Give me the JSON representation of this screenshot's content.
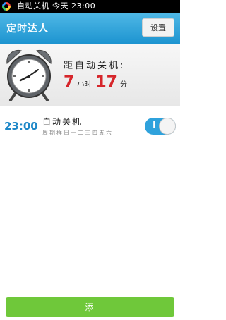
{
  "status_bar": {
    "text": "自动关机 今天 23:00"
  },
  "header": {
    "title": "定时达人",
    "settings_label": "设置"
  },
  "countdown": {
    "label": "距自动关机:",
    "hours": "7",
    "hours_unit": "小时",
    "minutes": "17",
    "minutes_unit": "分"
  },
  "alarm": {
    "time": "23:00",
    "name": "自动关机",
    "days": "周期样日一二三四五六",
    "toggle_label": "I",
    "enabled": true
  },
  "bottom": {
    "add_label": "添"
  },
  "colors": {
    "accent": "#1d94d0",
    "countdown_red": "#d6262b",
    "add_green": "#6fc83a"
  }
}
